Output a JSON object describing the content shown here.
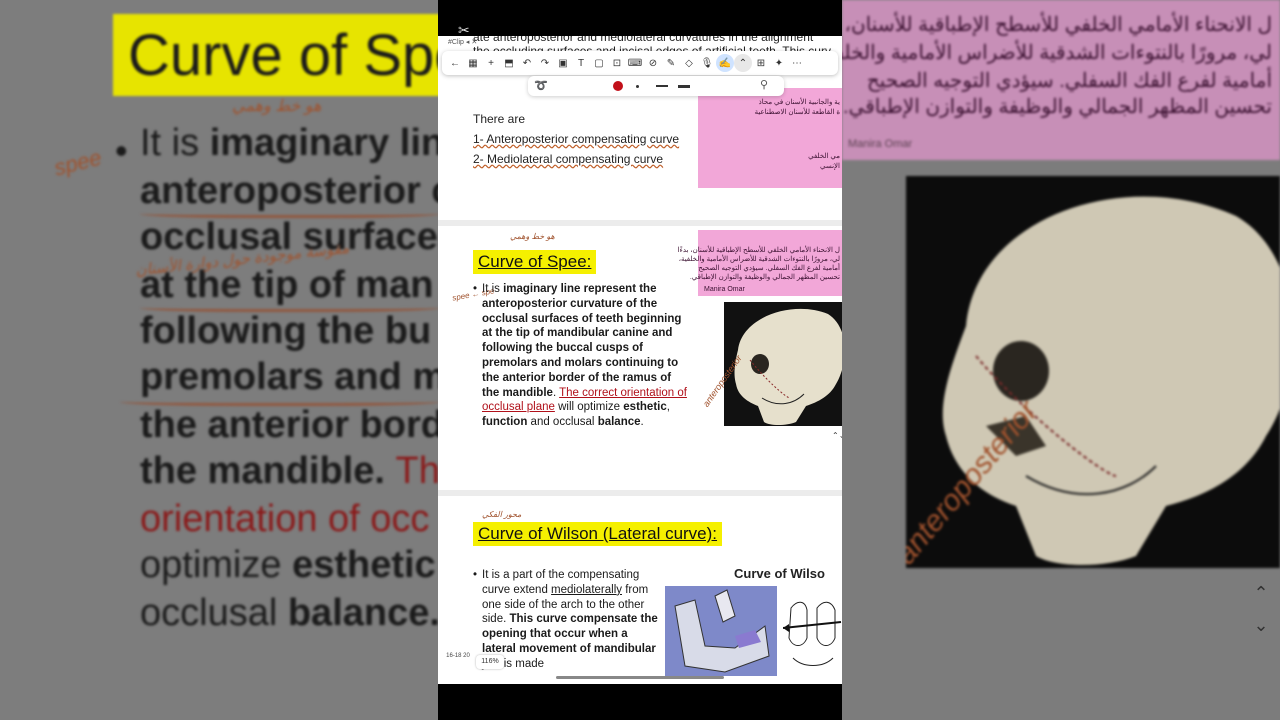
{
  "left_bg": {
    "title": "Curve of Spe",
    "bullet": "•",
    "lines": [
      {
        "pre": "It is ",
        "bold": "imaginary lin"
      },
      {
        "bold": "anteroposterior c"
      },
      {
        "bold": "occlusal surfaces"
      },
      {
        "bold": "at the tip of man"
      },
      {
        "bold": "following the bu"
      },
      {
        "bold": "premolars and m"
      },
      {
        "bold": "the anterior bord"
      },
      {
        "bold": "the mandible. ",
        "red": "Th"
      },
      {
        "red": "orientation of occ"
      },
      {
        "pre": "optimize ",
        "bold": "esthetic"
      },
      {
        "pre": "occlusal ",
        "bold": "balance."
      }
    ],
    "hand_notes": [
      "spee",
      "هو خط وهمي",
      "مقوسة موجودة حول دوارة الأسنان"
    ]
  },
  "right_bg": {
    "arabic_lines": [
      "ل الانحناء الأمامي الخلفي للأسطح الإطباقية للأسنان، بدءً",
      "لي، مرورًا بالنتوءات الشدقية للأضراس الأمامية والخلفية",
      "أمامية لفرع الفك السفلي. سيؤدي التوجيه الصحيح",
      "تحسين المظهر الجمالي والوظيفة والتوازن الإطباقي."
    ],
    "signature": "Manira Omar",
    "hand_note": "anteroposterior",
    "chevron_up": "⌃",
    "chevron_down": "⌄"
  },
  "phone": {
    "capcut_mark": "✂",
    "status_text": "#Clip ◂ ✕",
    "toolbar": {
      "buttons": [
        {
          "name": "back-icon",
          "glyph": "←"
        },
        {
          "name": "grid-icon",
          "glyph": "▦"
        },
        {
          "name": "add-icon",
          "glyph": "+"
        },
        {
          "name": "export-icon",
          "glyph": "⬒"
        },
        {
          "name": "undo-icon",
          "glyph": "↶"
        },
        {
          "name": "redo-icon",
          "glyph": "↷"
        },
        {
          "name": "image-icon",
          "glyph": "▣"
        },
        {
          "name": "text-icon",
          "glyph": "T"
        },
        {
          "name": "shape-icon",
          "glyph": "▢"
        },
        {
          "name": "stamp-icon",
          "glyph": "⊡"
        },
        {
          "name": "keyboard-icon",
          "glyph": "⌨"
        },
        {
          "name": "link-icon",
          "glyph": "⊘"
        },
        {
          "name": "pen-icon",
          "glyph": "✎"
        },
        {
          "name": "eraser-icon",
          "glyph": "◇"
        },
        {
          "name": "mic-icon",
          "glyph": "🎙"
        },
        {
          "name": "highlighter-icon",
          "glyph": "✍"
        },
        {
          "name": "collapse-icon",
          "glyph": "⌃"
        },
        {
          "name": "layers-icon",
          "glyph": "⊞"
        },
        {
          "name": "sparkle-icon",
          "glyph": "✦"
        },
        {
          "name": "more-icon",
          "glyph": "⋯"
        }
      ]
    },
    "page1": {
      "top_line_1": "ate anteroposterior and mediolateral curvatures in the alignment",
      "top_line_2": "the occluding surfaces and incisal edges of artificial teeth. This curv",
      "there_are": "There are",
      "items": [
        "1- Anteroposterior compensating curve",
        "2- Mediolateral compensating curve"
      ],
      "pink_arabic": [
        "ية والجانبية الأسنان في محاذ",
        "ة القاطعة للأسنان الاصطناعية",
        "مي الخلفي",
        "الإنسي"
      ]
    },
    "page2": {
      "title": "Curve of Spee:",
      "hand_top": "هو خط وهمي",
      "hand_spee": "spee ← spe",
      "bullet": "•",
      "body": {
        "p1": "It is ",
        "b1": "imaginary line represent the anteroposterior curvature of the occlusal surfaces of teeth beginning at the tip of mandibular canine and following the buccal cusps of premolars and molars continuing to the anterior border of the ramus of the mandible",
        "p2": ". ",
        "red": "The correct orientation of occlusal plane",
        "p3": " will optimize ",
        "b2": "esthetic",
        "p4": ", ",
        "b3": "function",
        "p5": " and occlusal ",
        "b4": "balance",
        "p6": "."
      },
      "pink_arabic": [
        "ل الانحناء الأمامي الخلفي للأسطح الإطباقية للأسنان، بدءًا",
        "لي، مرورًا بالنتوءات الشدقية للأضراس الأمامية والخلفية،",
        "أمامية لفرع الفك السفلي. سيؤدي التوجيه الصحيح",
        "تحسين المظهر الجمالي والوظيفة والتوازن الإطباقي."
      ],
      "pink_sig": "Manira Omar",
      "photo_note": "anteroposterior",
      "scroll_glyph": "⌃⌄"
    },
    "page3": {
      "hand_top": "محور الفكي",
      "title": "Curve of Wilson (Lateral curve):",
      "bullet": "•",
      "body": {
        "p1": "It is a part of the compensating curve extend ",
        "u1": "mediolaterally",
        "p2": " from one side of the arch to the other side. ",
        "b1": "This curve compensate the opening that occur when a lateral movement of mandibular jaw",
        "p3": " is made"
      },
      "fig_title": "Curve of Wilso"
    },
    "page_counter": "16-18 20",
    "zoom": "116%"
  },
  "colors": {
    "highlight_yellow": "#f5f000",
    "pink_note": "#f2a7d8",
    "red_text": "#b0101a",
    "handwriting": "#a0522d",
    "toolbar_active": "#1a5fd0"
  }
}
